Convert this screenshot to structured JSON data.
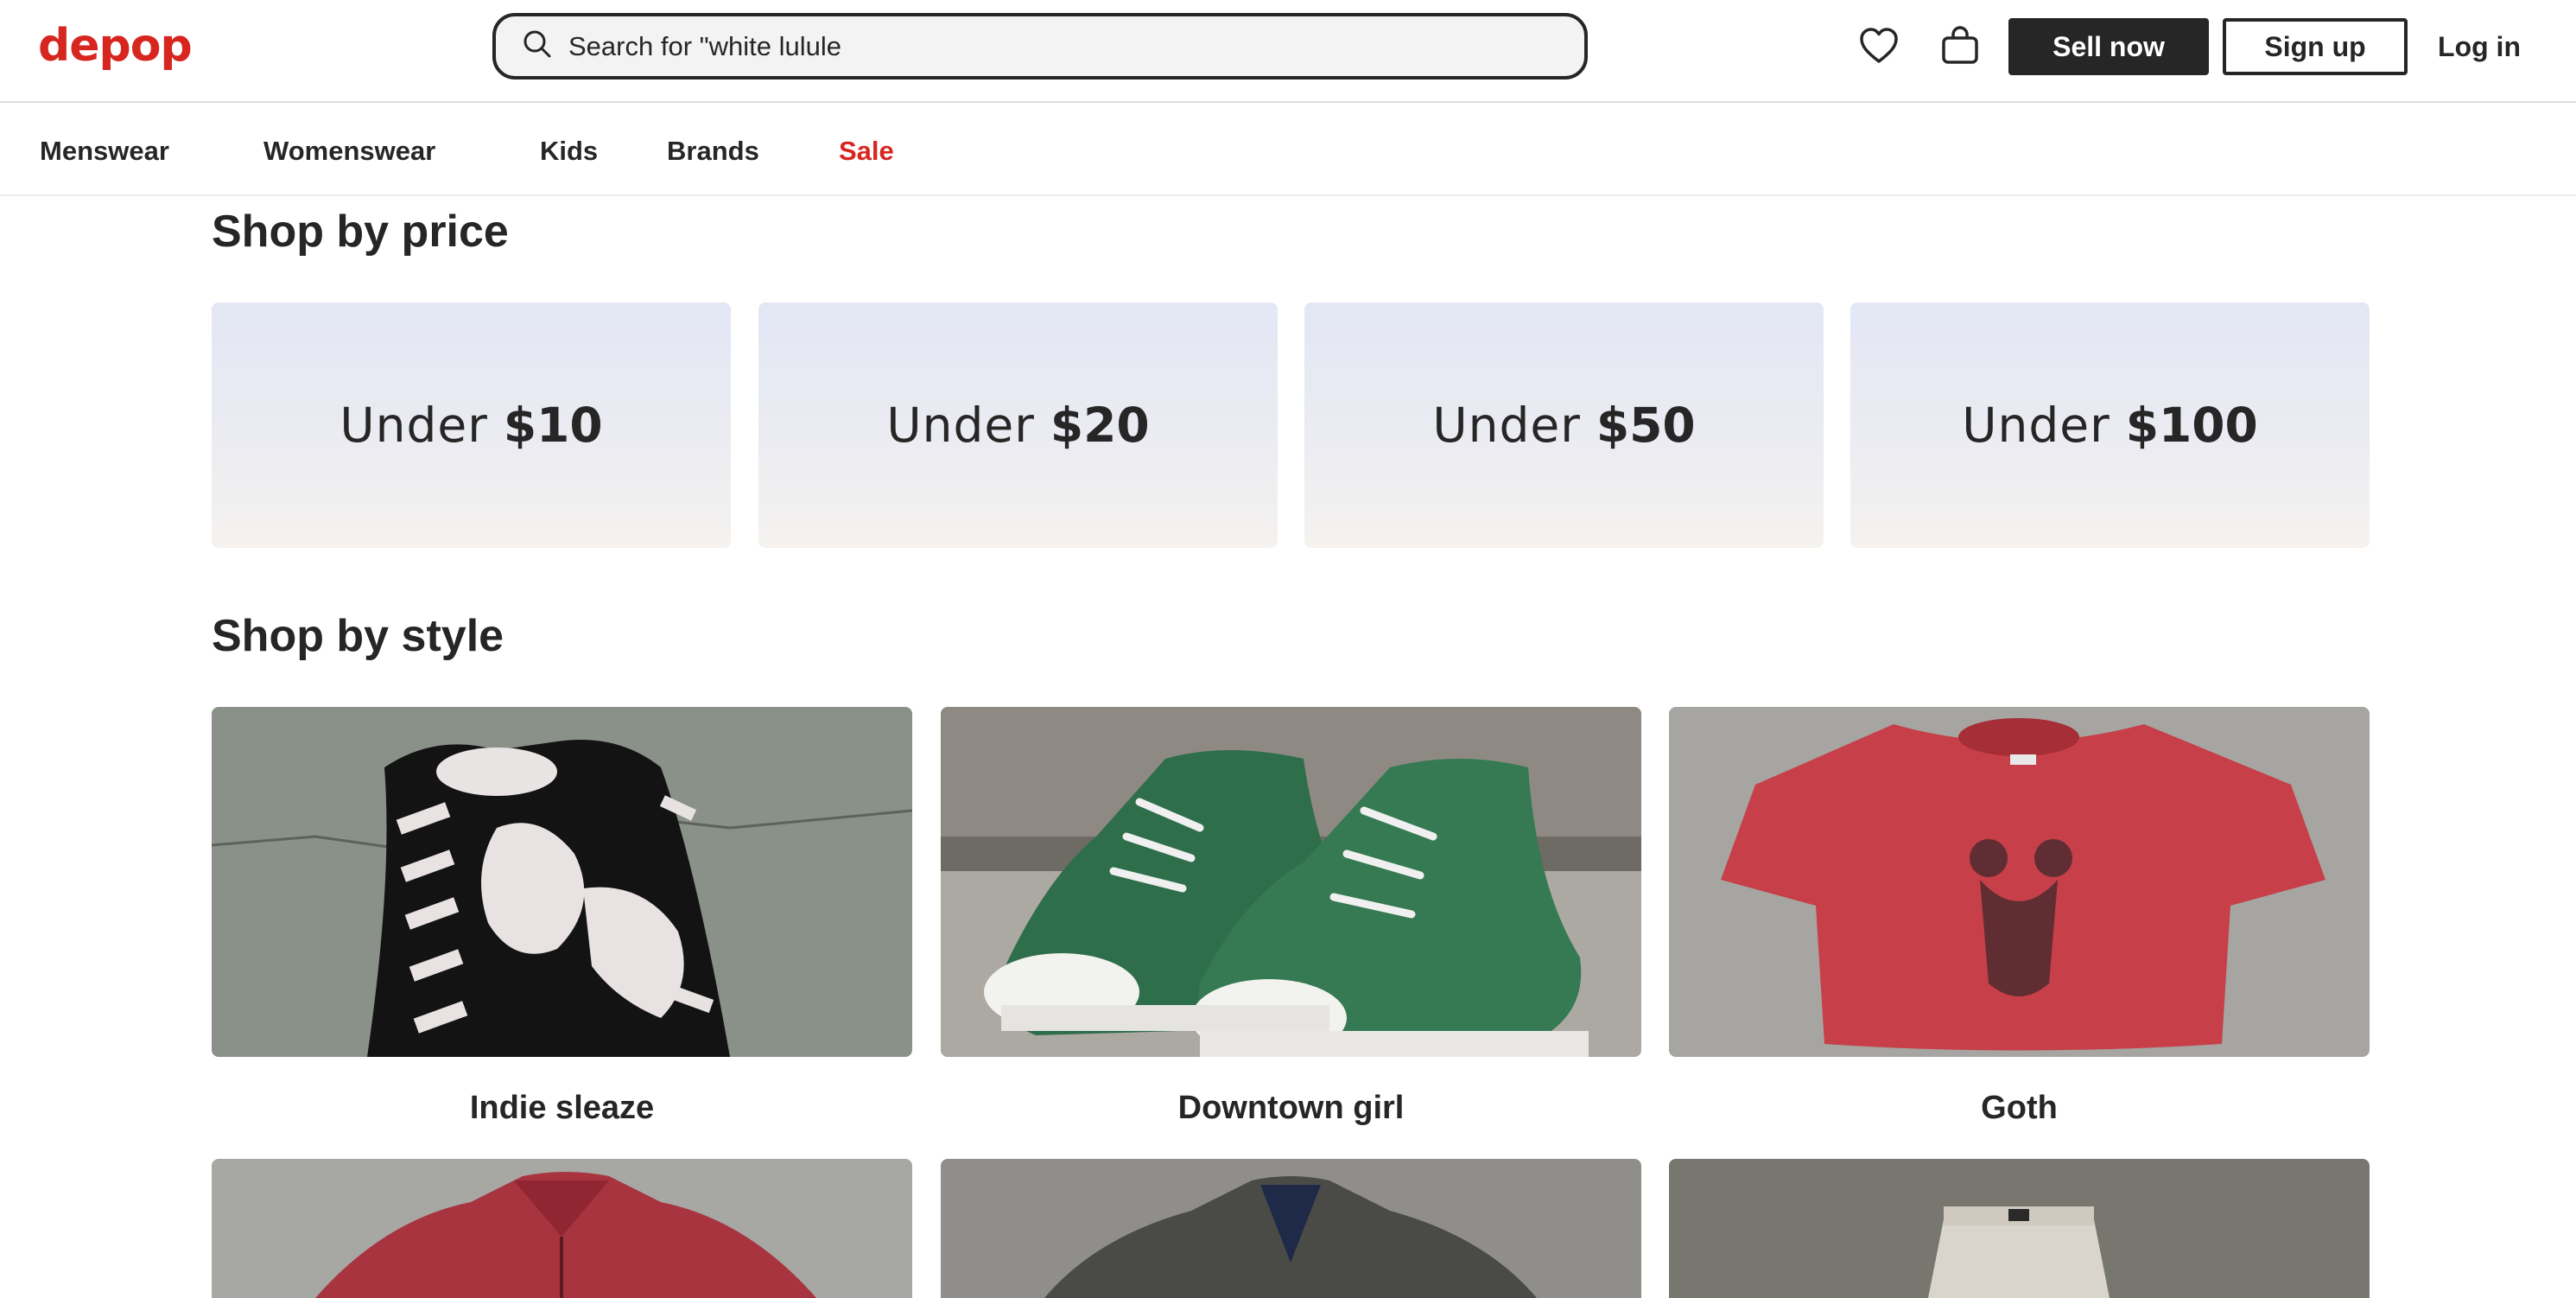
{
  "header": {
    "logo": "depop",
    "search_placeholder": "Search for \"white lululemon\"",
    "search_display": "Search for \"white lulule",
    "sell_label": "Sell now",
    "signup_label": "Sign up",
    "login_label": "Log in",
    "icons": [
      "search-icon",
      "heart-icon",
      "shopping-bag-icon"
    ]
  },
  "nav": {
    "items": [
      "Menswear",
      "Womenswear",
      "Kids",
      "Brands",
      "Sale"
    ]
  },
  "price_section": {
    "title": "Shop by price",
    "cards": [
      {
        "prefix": "Under",
        "amount": "$10"
      },
      {
        "prefix": "Under",
        "amount": "$20"
      },
      {
        "prefix": "Under",
        "amount": "$50"
      },
      {
        "prefix": "Under",
        "amount": "$100"
      }
    ]
  },
  "style_section": {
    "title": "Shop by style",
    "items": [
      {
        "label": "Indie sleaze"
      },
      {
        "label": "Downtown girl"
      },
      {
        "label": "Goth"
      }
    ]
  },
  "colors": {
    "brand_red": "#d6261f",
    "text_dark": "#262626",
    "search_bg": "#f3f3f3"
  }
}
